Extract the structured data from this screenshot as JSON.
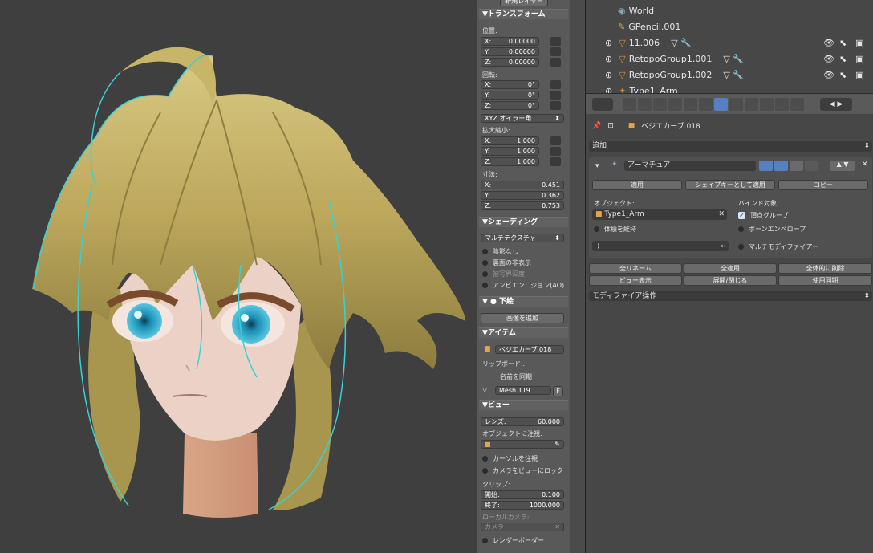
{
  "npanel": {
    "new_layer": "新規レイヤー",
    "transform": {
      "title": "▼トランスフォーム",
      "location_label": "位置:",
      "location": [
        {
          "axis": "X:",
          "value": "0.00000"
        },
        {
          "axis": "Y:",
          "value": "0.00000"
        },
        {
          "axis": "Z:",
          "value": "0.00000"
        }
      ],
      "rotation_label": "回転:",
      "rotation": [
        {
          "axis": "X:",
          "value": "0°"
        },
        {
          "axis": "Y:",
          "value": "0°"
        },
        {
          "axis": "Z:",
          "value": "0°"
        }
      ],
      "rotation_mode": "XYZ オイラー角",
      "scale_label": "拡大縮小:",
      "scale": [
        {
          "axis": "X:",
          "value": "1.000"
        },
        {
          "axis": "Y:",
          "value": "1.000"
        },
        {
          "axis": "Z:",
          "value": "1.000"
        }
      ],
      "dimensions_label": "寸法:",
      "dimensions": [
        {
          "axis": "X:",
          "value": "0.451"
        },
        {
          "axis": "Y:",
          "value": "0.362"
        },
        {
          "axis": "Z:",
          "value": "0.753"
        }
      ]
    },
    "shading": {
      "title": "▼シェーディング",
      "mode": "マルチテクスチャ",
      "options": [
        "陰影なし",
        "裏面の非表示",
        "被写界深度",
        "アンビエン...ジョン(AO)"
      ]
    },
    "background": {
      "title": "▼ ● 下絵",
      "add_image": "画像を追加"
    },
    "item": {
      "title": "▼アイテム",
      "object_name": "ベジエカーブ.018",
      "clipboard": "リップボード...",
      "sync_name": "名前を同期",
      "mesh": "Mesh.119",
      "mesh_f": "F"
    },
    "view": {
      "title": "▼ビュー",
      "lens_label": "レンズ:",
      "lens": "60.000",
      "lock_object_label": "オブジェクトに注視:",
      "lock_cursor": "カーソルを注視",
      "lock_camera": "カメラをビューにロック",
      "clip_label": "クリップ:",
      "clip_start_label": "開始:",
      "clip_start": "0.100",
      "clip_end_label": "終了:",
      "clip_end": "1000.000",
      "local_camera_label": "ローカルカメラ:",
      "camera": "カメラ",
      "render_border": "レンダーボーダー"
    }
  },
  "outliner": {
    "rows": [
      "World",
      "GPencil.001",
      "11.006",
      "RetopoGroup1.001",
      "RetopoGroup1.002",
      "Type1_Arm"
    ]
  },
  "properties": {
    "breadcrumb": "ベジエカーブ.018",
    "add_modifier": "追加",
    "modifier_name": "アーマチュア",
    "apply": "適用",
    "apply_shape": "シェイプキーとして適用",
    "copy": "コピー",
    "object_label": "オブジェクト:",
    "object_value": "Type1_Arm",
    "bind_label": "バインド対象:",
    "vertex_groups": "頂点グループ",
    "bone_envelopes": "ボーンエンベロープ",
    "preserve_volume": "体積を維持",
    "multi_modifier": "マルチモディファイアー",
    "rename_all": "全リネーム",
    "apply_all": "全適用",
    "delete_all": "全体的に削除",
    "viewport_display": "ビュー表示",
    "expand_collapse": "展開/閉じる",
    "toggle_sync": "使用同期",
    "modifier_ops": "モディファイア操作"
  },
  "colors": {
    "viewport_bg": "#3f3f3f",
    "hair": "#c9b76a",
    "outline": "#34d3d6",
    "skin": "#ecd2c6",
    "eye": "#2aa7c8",
    "highlight": "#5680c2"
  }
}
